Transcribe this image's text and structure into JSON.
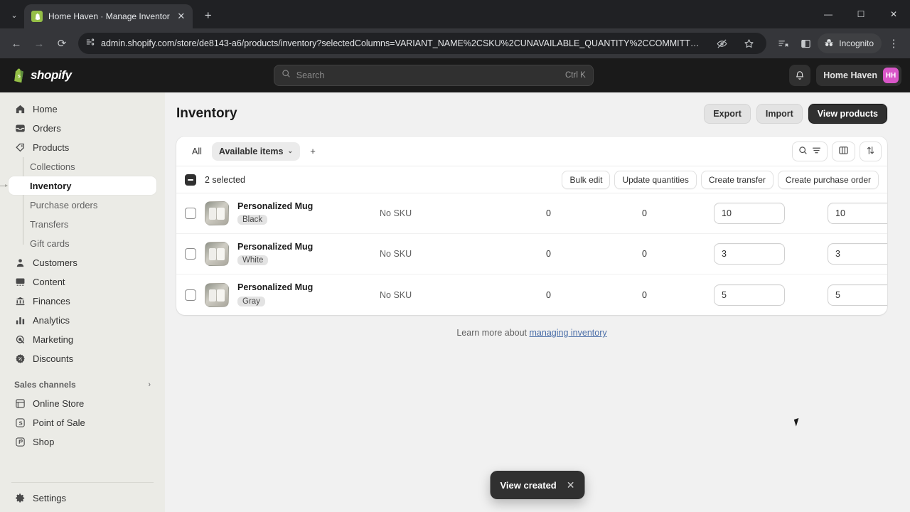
{
  "browser": {
    "tab": {
      "title": "Home Haven · Manage Inventor",
      "favicon": "shopify-bag-icon",
      "close": "✕"
    },
    "newtab_label": "+",
    "window": {
      "minimize": "—",
      "maximize": "☐",
      "close": "✕"
    },
    "nav": {
      "back": "←",
      "forward": "→",
      "reload": "⟳"
    },
    "url": "admin.shopify.com/store/de8143-a6/products/inventory?selectedColumns=VARIANT_NAME%2CSKU%2CUNAVAILABLE_QUANTITY%2CCOMMITT…",
    "site_info_icon": "page-info-icon",
    "toolbar_icons": [
      "eye-off-icon",
      "star-icon",
      "reading-list-icon",
      "split-view-icon"
    ],
    "incognito_label": "Incognito",
    "menu_icon": "⋮"
  },
  "topbar": {
    "logo_text": "shopify",
    "search": {
      "placeholder": "Search",
      "shortcut": "Ctrl K"
    },
    "notifications_icon": "bell-icon",
    "store_name": "Home Haven",
    "avatar_initials": "HH",
    "avatar_color": "#d956c8"
  },
  "sidebar": {
    "items": [
      {
        "label": "Home",
        "icon": "home-icon",
        "name": "home"
      },
      {
        "label": "Orders",
        "icon": "orders-icon",
        "name": "orders"
      },
      {
        "label": "Products",
        "icon": "tag-icon",
        "name": "products"
      }
    ],
    "sub_items": [
      {
        "label": "Collections",
        "name": "collections",
        "active": false
      },
      {
        "label": "Inventory",
        "name": "inventory",
        "active": true
      },
      {
        "label": "Purchase orders",
        "name": "purchase-orders",
        "active": false
      },
      {
        "label": "Transfers",
        "name": "transfers",
        "active": false
      },
      {
        "label": "Gift cards",
        "name": "gift-cards",
        "active": false
      }
    ],
    "items2": [
      {
        "label": "Customers",
        "icon": "person-icon",
        "name": "customers"
      },
      {
        "label": "Content",
        "icon": "content-icon",
        "name": "content"
      },
      {
        "label": "Finances",
        "icon": "bank-icon",
        "name": "finances"
      },
      {
        "label": "Analytics",
        "icon": "bar-chart-icon",
        "name": "analytics"
      },
      {
        "label": "Marketing",
        "icon": "megaphone-icon",
        "name": "marketing"
      },
      {
        "label": "Discounts",
        "icon": "discount-icon",
        "name": "discounts"
      }
    ],
    "section_title": "Sales channels",
    "section_chevron": "›",
    "channels": [
      {
        "label": "Online Store",
        "icon": "storefront-icon",
        "name": "online-store"
      },
      {
        "label": "Point of Sale",
        "icon": "pos-icon",
        "name": "point-of-sale"
      },
      {
        "label": "Shop",
        "icon": "shop-icon",
        "name": "shop"
      }
    ],
    "settings": {
      "label": "Settings",
      "icon": "gear-icon"
    }
  },
  "page": {
    "title": "Inventory",
    "actions": {
      "export": "Export",
      "import": "Import",
      "view_products": "View products"
    }
  },
  "card": {
    "tabs": [
      {
        "label": "All",
        "name": "tab-all",
        "selected": false
      },
      {
        "label": "Available items",
        "name": "tab-available-items",
        "selected": true,
        "chevron": "⌄"
      }
    ],
    "add_tab": "+",
    "tools": {
      "search_filter": {
        "search_icon": "search-icon",
        "filter_icon": "filter-icon"
      },
      "columns_icon": "columns-icon",
      "sort_icon": "sort-icon"
    },
    "bulk": {
      "selected_label": "2 selected",
      "checkbox_state": "indeterminate",
      "actions": [
        {
          "label": "Bulk edit",
          "name": "bulk-edit"
        },
        {
          "label": "Update quantities",
          "name": "update-quantities"
        },
        {
          "label": "Create transfer",
          "name": "create-transfer"
        },
        {
          "label": "Create purchase order",
          "name": "create-purchase-order"
        }
      ]
    },
    "rows": [
      {
        "checked": false,
        "product": "Personalized Mug",
        "variant": "Black",
        "sku": "No SKU",
        "unavailable": "0",
        "committed": "0",
        "available": "10",
        "on_hand": "10"
      },
      {
        "checked": false,
        "product": "Personalized Mug",
        "variant": "White",
        "sku": "No SKU",
        "unavailable": "0",
        "committed": "0",
        "available": "3",
        "on_hand": "3"
      },
      {
        "checked": false,
        "product": "Personalized Mug",
        "variant": "Gray",
        "sku": "No SKU",
        "unavailable": "0",
        "committed": "0",
        "available": "5",
        "on_hand": "5"
      }
    ]
  },
  "footnote": {
    "text": "Learn more about ",
    "link": "managing inventory"
  },
  "toast": {
    "message": "View created",
    "close": "✕"
  }
}
